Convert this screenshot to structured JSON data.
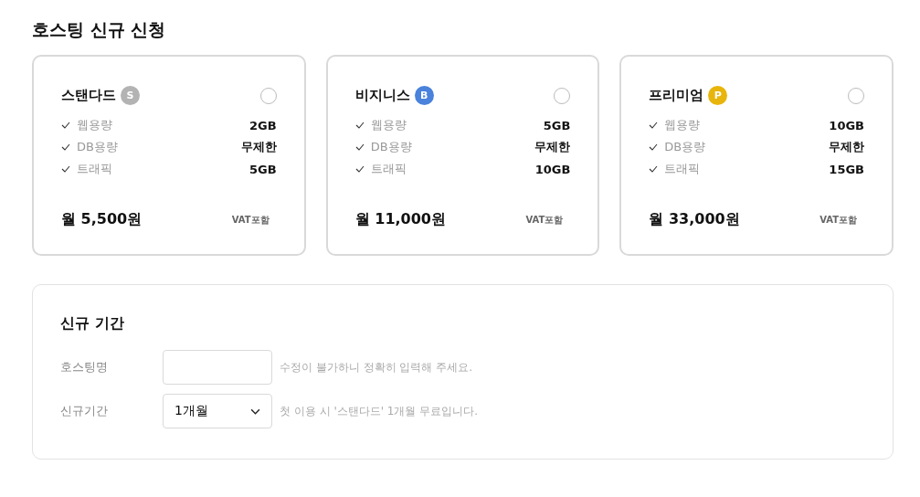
{
  "title": "호스팅 신규 신청",
  "plans": [
    {
      "name": "스탠다드",
      "badge": "S",
      "color": "#b3b3b3",
      "selected": false,
      "specs": [
        {
          "label": "웹용량",
          "value": "2GB"
        },
        {
          "label": "DB용량",
          "value": "무제한"
        },
        {
          "label": "트래픽",
          "value": "5GB"
        }
      ],
      "price": "월 5,500원",
      "vat": "VAT포함"
    },
    {
      "name": "비지니스",
      "badge": "B",
      "color": "#4a82dc",
      "selected": false,
      "specs": [
        {
          "label": "웹용량",
          "value": "5GB"
        },
        {
          "label": "DB용량",
          "value": "무제한"
        },
        {
          "label": "트래픽",
          "value": "10GB"
        }
      ],
      "price": "월 11,000원",
      "vat": "VAT포함"
    },
    {
      "name": "프리미엄",
      "badge": "P",
      "color": "#e8b50c",
      "selected": false,
      "specs": [
        {
          "label": "웹용량",
          "value": "10GB"
        },
        {
          "label": "DB용량",
          "value": "무제한"
        },
        {
          "label": "트래픽",
          "value": "15GB"
        }
      ],
      "price": "월 33,000원",
      "vat": "VAT포함"
    }
  ],
  "period": {
    "title": "신규 기간",
    "name_field": {
      "label": "호스팅명",
      "hint": "수정이 불가하니 정확히 입력해 주세요."
    },
    "period_field": {
      "label": "신규기간",
      "value": "1개월",
      "hint": "첫 이용 시 '스탠다드' 1개월 무료입니다."
    }
  }
}
